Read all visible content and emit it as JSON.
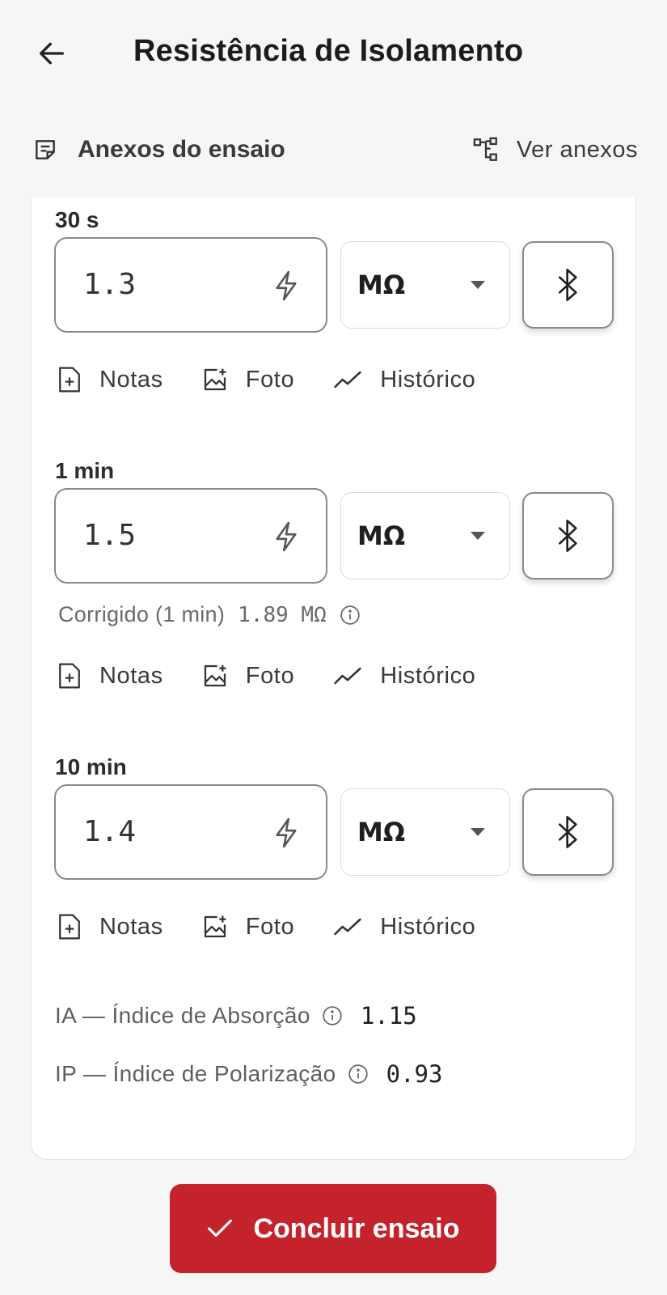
{
  "header": {
    "title": "Resistência de Isolamento"
  },
  "attachments": {
    "label": "Anexos do ensaio",
    "view_label": "Ver anexos"
  },
  "readings": [
    {
      "label": "30 s",
      "value": "1.3",
      "unit": "MΩ"
    },
    {
      "label": "1 min",
      "value": "1.5",
      "unit": "MΩ",
      "corrected_label": "Corrigido (1 min)",
      "corrected_value": "1.89 MΩ"
    },
    {
      "label": "10 min",
      "value": "1.4",
      "unit": "MΩ"
    }
  ],
  "actions": {
    "notes": "Notas",
    "photo": "Foto",
    "history": "Histórico"
  },
  "indices": {
    "ia_label": "IA — Índice de Absorção",
    "ia_value": "1.15",
    "ip_label": "IP — Índice de Polarização",
    "ip_value": "0.93"
  },
  "footer": {
    "done_label": "Concluir ensaio"
  },
  "colors": {
    "accent": "#c4232b",
    "background": "#f6f6f7",
    "card": "#ffffff"
  },
  "icons": {
    "back": "arrow-left-icon",
    "attachments": "notes-icon",
    "view_attachments": "tree-icon",
    "value_source": "bolt-icon",
    "unit_dropdown": "caret-down-icon",
    "bluetooth": "bluetooth-icon",
    "notes": "file-plus-icon",
    "photo": "image-plus-icon",
    "history": "trend-icon",
    "info": "info-icon",
    "done": "check-icon"
  }
}
